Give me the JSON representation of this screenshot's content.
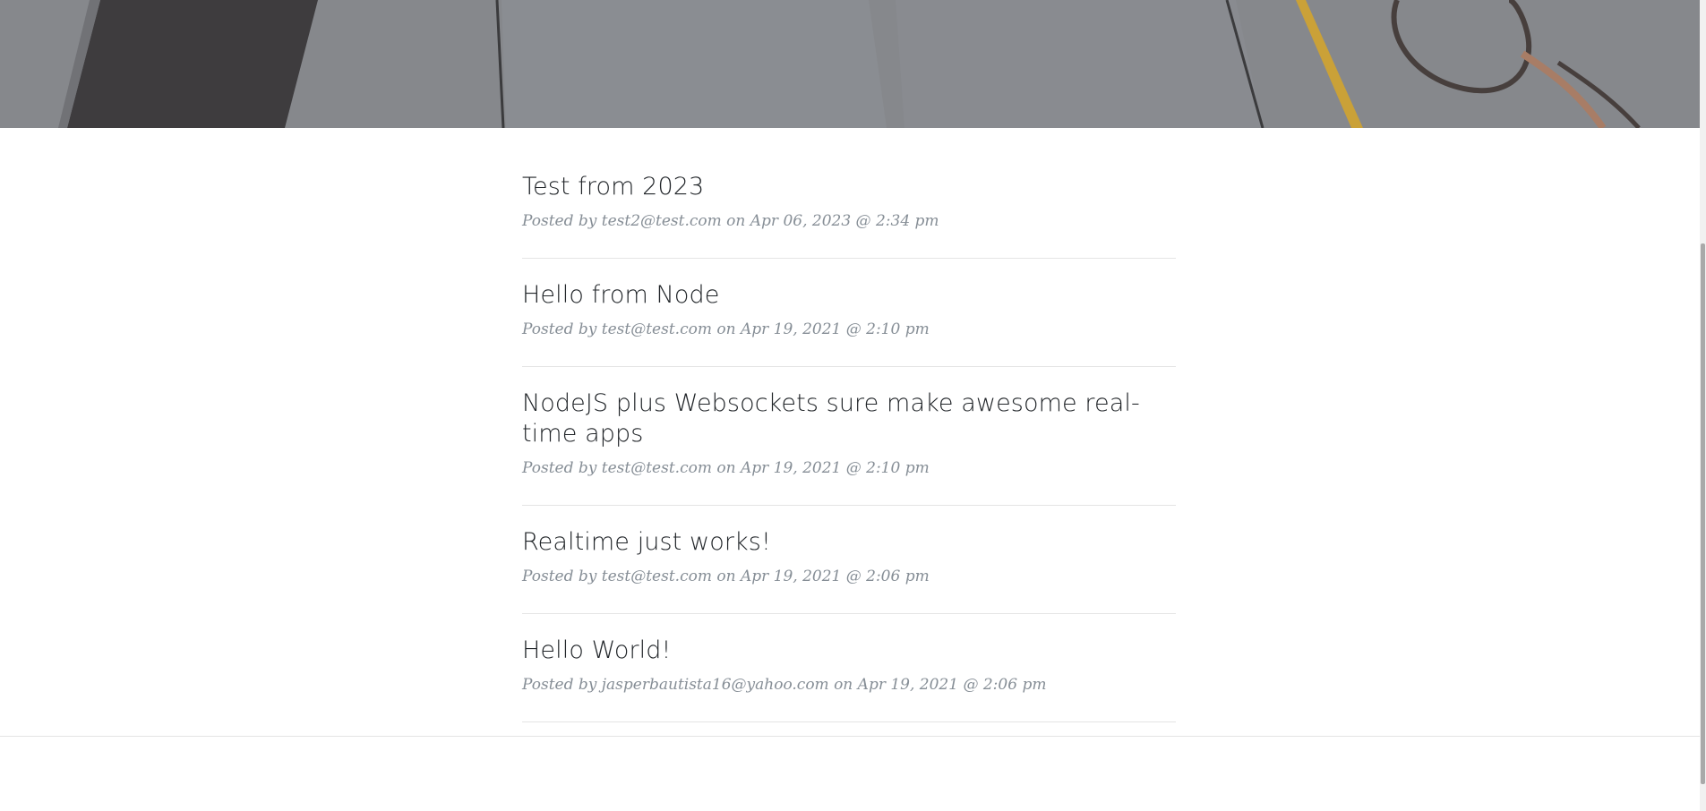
{
  "posts": [
    {
      "title": "Test from 2023",
      "meta": "Posted by test2@test.com on Apr 06, 2023 @ 2:34 pm"
    },
    {
      "title": "Hello from Node",
      "meta": "Posted by test@test.com on Apr 19, 2021 @ 2:10 pm"
    },
    {
      "title": "NodeJS plus Websockets sure make awesome real-time apps",
      "meta": "Posted by test@test.com on Apr 19, 2021 @ 2:10 pm"
    },
    {
      "title": "Realtime just works!",
      "meta": "Posted by test@test.com on Apr 19, 2021 @ 2:06 pm"
    },
    {
      "title": "Hello World!",
      "meta": "Posted by jasperbautista16@yahoo.com on Apr 19, 2021 @ 2:06 pm"
    }
  ]
}
